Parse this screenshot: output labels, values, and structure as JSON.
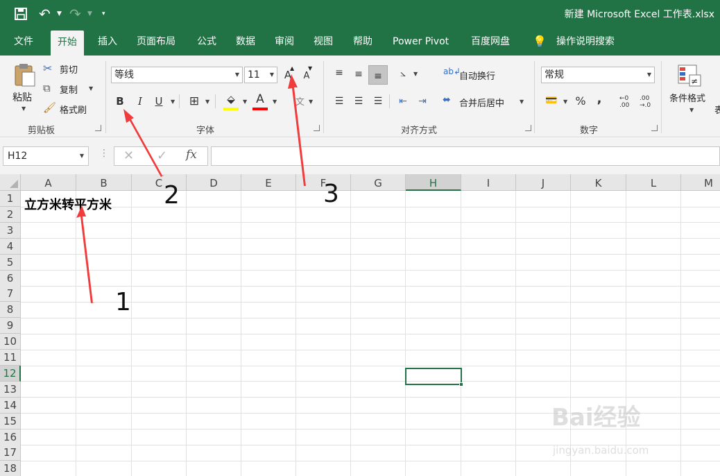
{
  "window": {
    "title": "新建 Microsoft Excel 工作表.xlsx"
  },
  "quick_access": {
    "save_icon": "save-icon",
    "undo_icon": "undo-icon",
    "redo_icon": "redo-icon",
    "customize_icon": "customize-icon"
  },
  "tabs": [
    {
      "label": "文件"
    },
    {
      "label": "开始"
    },
    {
      "label": "插入"
    },
    {
      "label": "页面布局"
    },
    {
      "label": "公式"
    },
    {
      "label": "数据"
    },
    {
      "label": "审阅"
    },
    {
      "label": "视图"
    },
    {
      "label": "帮助"
    },
    {
      "label": "Power Pivot"
    },
    {
      "label": "百度网盘"
    },
    {
      "label": "操作说明搜索"
    }
  ],
  "ribbon": {
    "clipboard": {
      "label": "剪贴板",
      "paste": "粘贴",
      "cut": "剪切",
      "copy": "复制",
      "format_painter": "格式刷"
    },
    "font": {
      "label": "字体",
      "font_name": "等线",
      "font_size": "11",
      "increase": "A",
      "decrease": "A",
      "bold": "B",
      "italic": "I",
      "underline": "U",
      "font_color_letter": "A",
      "fill_color": "#ffff00",
      "font_color": "#ff0000"
    },
    "alignment": {
      "label": "对齐方式",
      "wrap_text": "自动换行",
      "merge_center": "合并后居中"
    },
    "number": {
      "label": "数字",
      "format": "常规",
      "percent": "%",
      "comma": ","
    },
    "styles": {
      "conditional_format": "条件格式",
      "truncated": "表"
    }
  },
  "formula_bar": {
    "name_box": "H12",
    "fx": "fx",
    "value": ""
  },
  "columns": [
    "A",
    "B",
    "C",
    "D",
    "E",
    "F",
    "G",
    "H",
    "I",
    "J",
    "K",
    "L",
    "M"
  ],
  "rows": [
    "1",
    "2",
    "3",
    "4",
    "5",
    "6",
    "7",
    "8",
    "9",
    "10",
    "11",
    "12",
    "13",
    "14",
    "15",
    "16",
    "17",
    "18"
  ],
  "cells": {
    "A1": "立方米转平方米"
  },
  "selection": {
    "cell": "H12",
    "column": "H",
    "row": "12"
  },
  "annotations": [
    {
      "label": "1"
    },
    {
      "label": "2"
    },
    {
      "label": "3"
    }
  ],
  "annotation_color": "#f03c3c",
  "accent_color": "#217346",
  "watermark": {
    "logo": "Bai经验",
    "url": "jingyan.baidu.com"
  }
}
